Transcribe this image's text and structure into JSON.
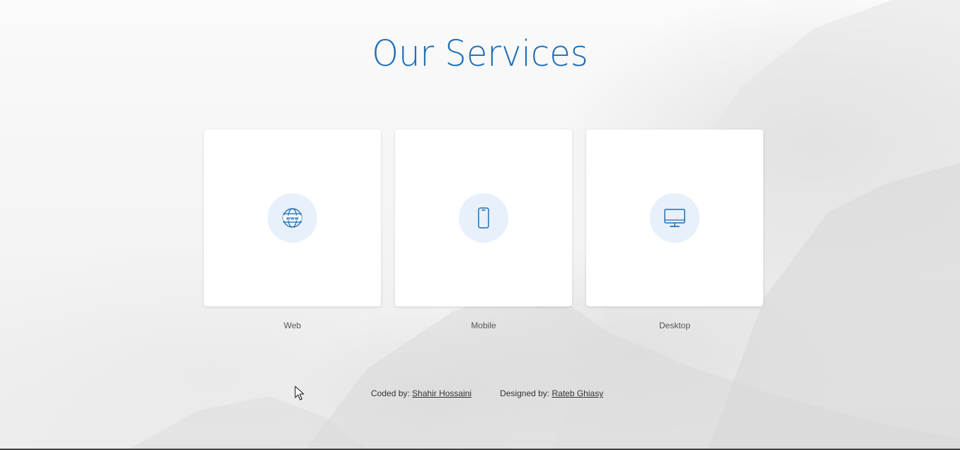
{
  "page": {
    "title": "Our Services"
  },
  "services": [
    {
      "label": "Web",
      "icon": "globe-www-icon"
    },
    {
      "label": "Mobile",
      "icon": "smartphone-icon"
    },
    {
      "label": "Desktop",
      "icon": "monitor-icon"
    }
  ],
  "footer": {
    "coded_label": "Coded by:",
    "coded_name": "Shahir Hossaini",
    "designed_label": "Designed by:",
    "designed_name": "Rateb Ghiasy"
  },
  "colors": {
    "accent": "#1f6fb5",
    "icon_bg": "#e7f0fb",
    "card_bg": "#ffffff"
  }
}
